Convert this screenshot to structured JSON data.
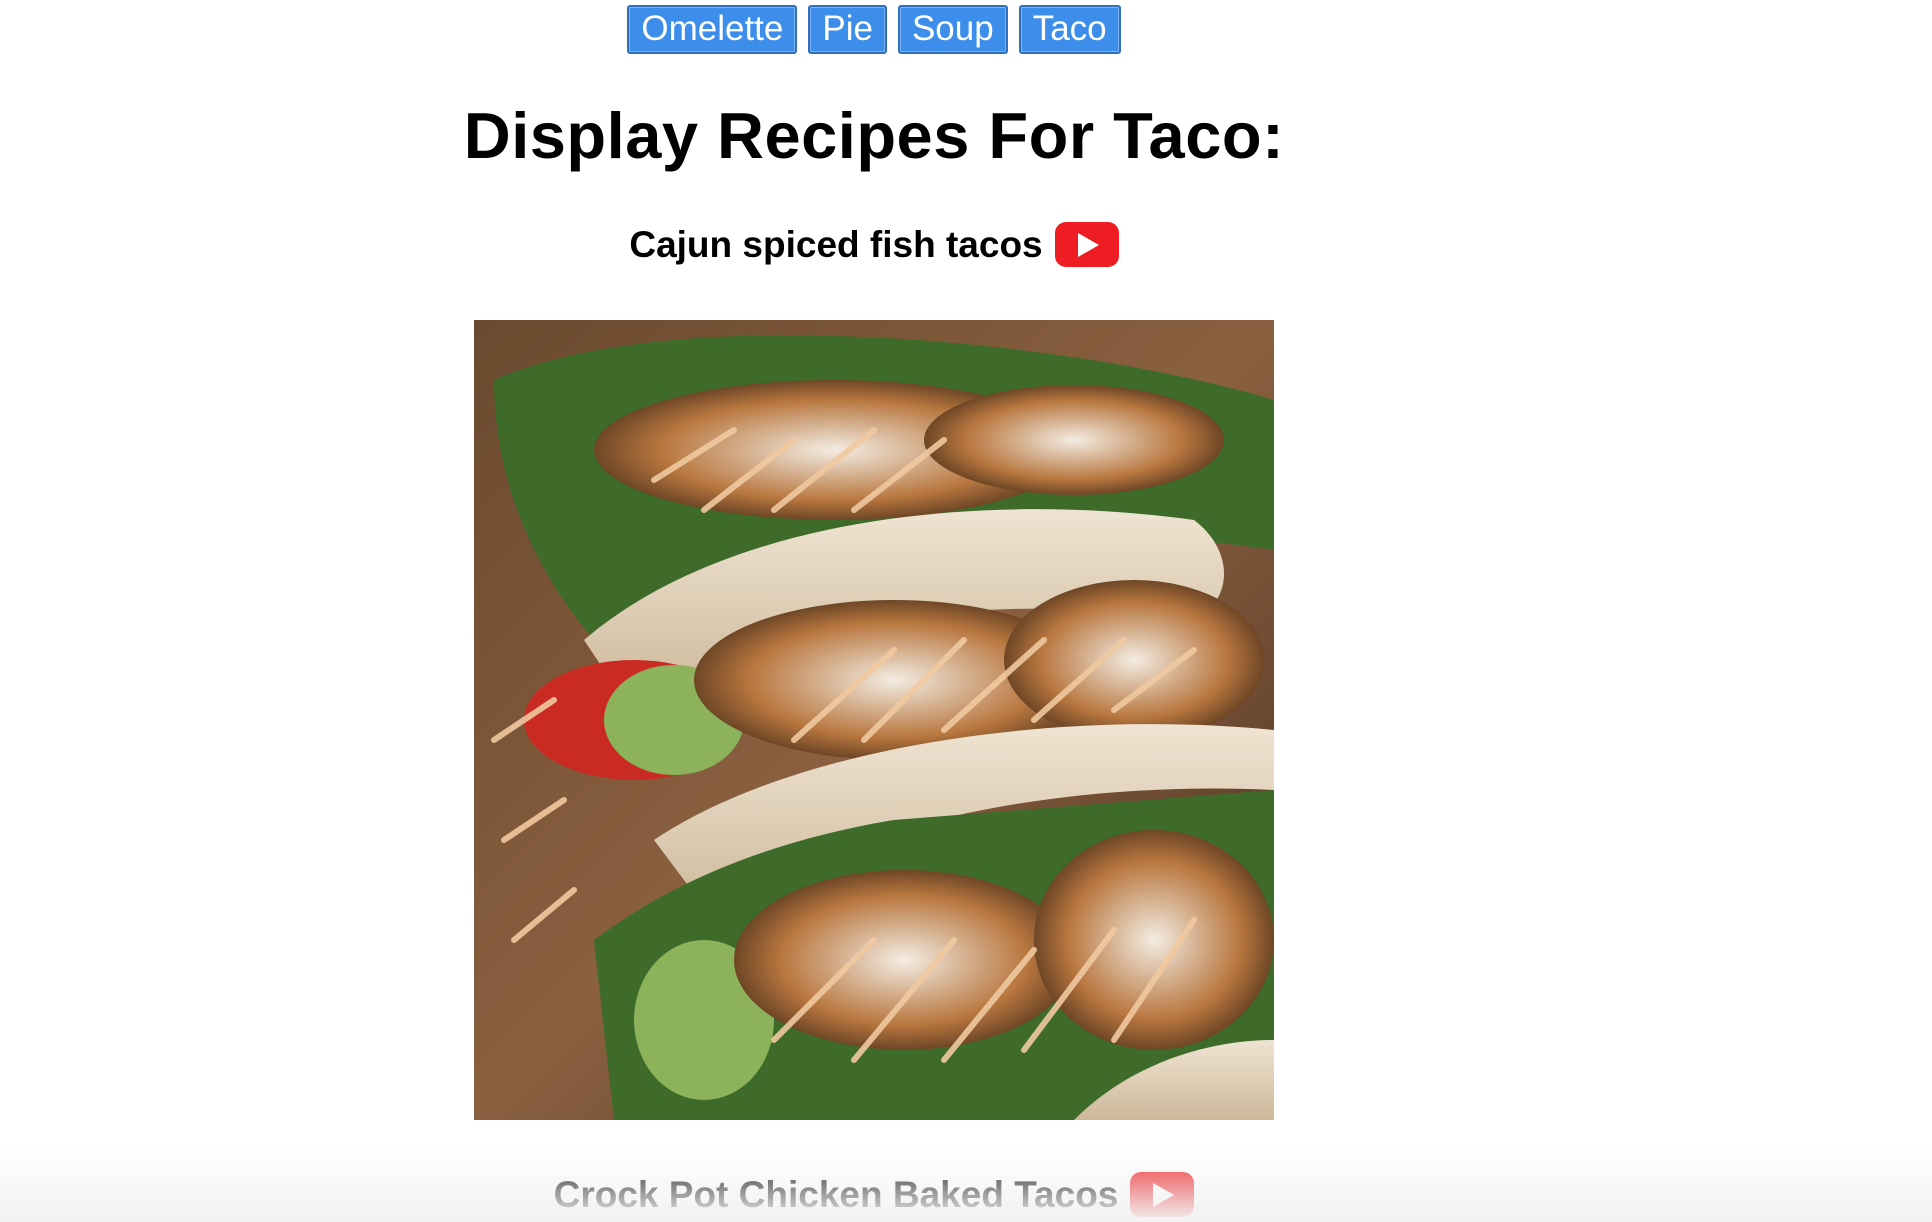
{
  "nav": {
    "buttons": [
      {
        "label": "Omelette"
      },
      {
        "label": "Pie"
      },
      {
        "label": "Soup"
      },
      {
        "label": "Taco"
      }
    ]
  },
  "main": {
    "heading": "Display Recipes For Taco:",
    "recipes": [
      {
        "title": "Cajun spiced fish tacos",
        "video_icon": "youtube-play-icon",
        "image": "fish-tacos-photo"
      },
      {
        "title": "Crock Pot Chicken Baked Tacos",
        "video_icon": "youtube-play-icon"
      }
    ]
  },
  "colors": {
    "button_bg": "#3d8eeb",
    "youtube_red": "#ee1d23"
  }
}
